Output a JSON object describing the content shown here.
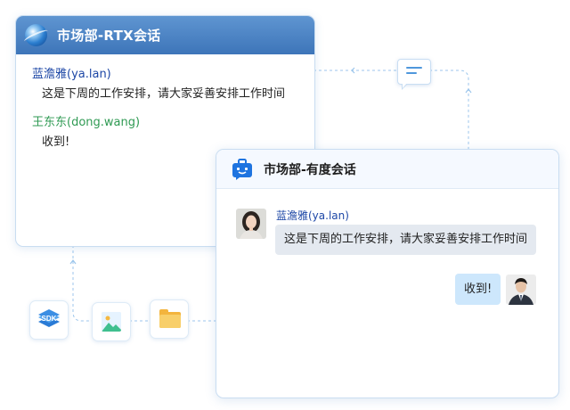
{
  "rtx_window": {
    "title": "市场部-RTX会话",
    "messages": [
      {
        "sender": "蓝澹雅(ya.lan)",
        "text": "这是下周的工作安排，请大家妥善安排工作时间",
        "sender_color": "#1d47a6"
      },
      {
        "sender": "王东东(dong.wang)",
        "text": "收到!",
        "sender_color": "#2f9a53"
      }
    ]
  },
  "youdu_window": {
    "title": "市场部-有度会话",
    "incoming": {
      "sender": "蓝澹雅(ya.lan)",
      "text": "这是下周的工作安排，请大家妥善安排工作时间"
    },
    "outgoing": {
      "text": "收到!"
    }
  },
  "tools": [
    {
      "icon": "sdk-icon",
      "label": "SDK"
    },
    {
      "icon": "image-icon"
    },
    {
      "icon": "folder-icon"
    }
  ],
  "colors": {
    "rtx_header": "#4a84c5",
    "connector": "#9cc6ec",
    "incoming_bubble": "#e4e9f0",
    "outgoing_bubble": "#cde7fc"
  }
}
